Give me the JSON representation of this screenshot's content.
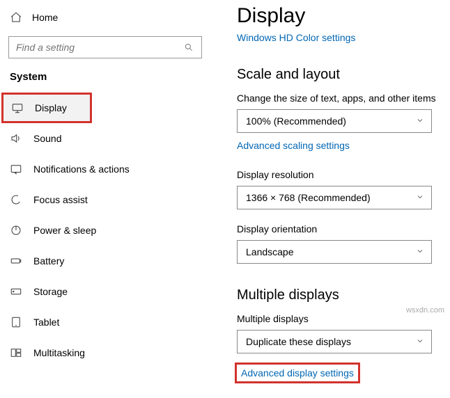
{
  "sidebar": {
    "home_label": "Home",
    "search_placeholder": "Find a setting",
    "section_label": "System",
    "items": [
      {
        "label": "Display"
      },
      {
        "label": "Sound"
      },
      {
        "label": "Notifications & actions"
      },
      {
        "label": "Focus assist"
      },
      {
        "label": "Power & sleep"
      },
      {
        "label": "Battery"
      },
      {
        "label": "Storage"
      },
      {
        "label": "Tablet"
      },
      {
        "label": "Multitasking"
      }
    ]
  },
  "main": {
    "title": "Display",
    "hd_color_link": "Windows HD Color settings",
    "scale": {
      "heading": "Scale and layout",
      "size_label": "Change the size of text, apps, and other items",
      "size_value": "100% (Recommended)",
      "advanced_scaling_link": "Advanced scaling settings",
      "resolution_label": "Display resolution",
      "resolution_value": "1366 × 768 (Recommended)",
      "orientation_label": "Display orientation",
      "orientation_value": "Landscape"
    },
    "multiple": {
      "heading": "Multiple displays",
      "label": "Multiple displays",
      "value": "Duplicate these displays",
      "advanced_link": "Advanced display settings"
    }
  },
  "watermark": "wsxdn.com"
}
